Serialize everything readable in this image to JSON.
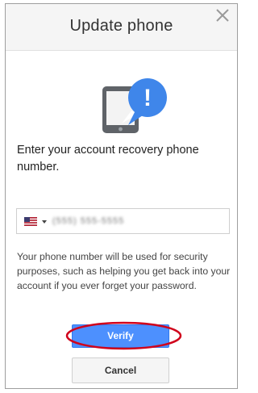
{
  "dialog": {
    "title": "Update phone",
    "close_icon": "close-icon"
  },
  "illustration": {
    "icon": "phone-alert-icon",
    "alert_glyph": "!",
    "colors": {
      "phone": "#5f6368",
      "screen": "#f3f3f3",
      "badge": "#3f86ea"
    }
  },
  "prompt": "Enter your account recovery phone number.",
  "phone_field": {
    "country_flag": "us-flag-icon",
    "value": "(555) 555-5555"
  },
  "info": "Your phone number will be used for security purposes, such as helping you get back into your account if you ever forget your password.",
  "buttons": {
    "verify_label": "Verify",
    "cancel_label": "Cancel"
  },
  "colors": {
    "accent": "#4d90fe",
    "highlight": "#d0021b"
  }
}
